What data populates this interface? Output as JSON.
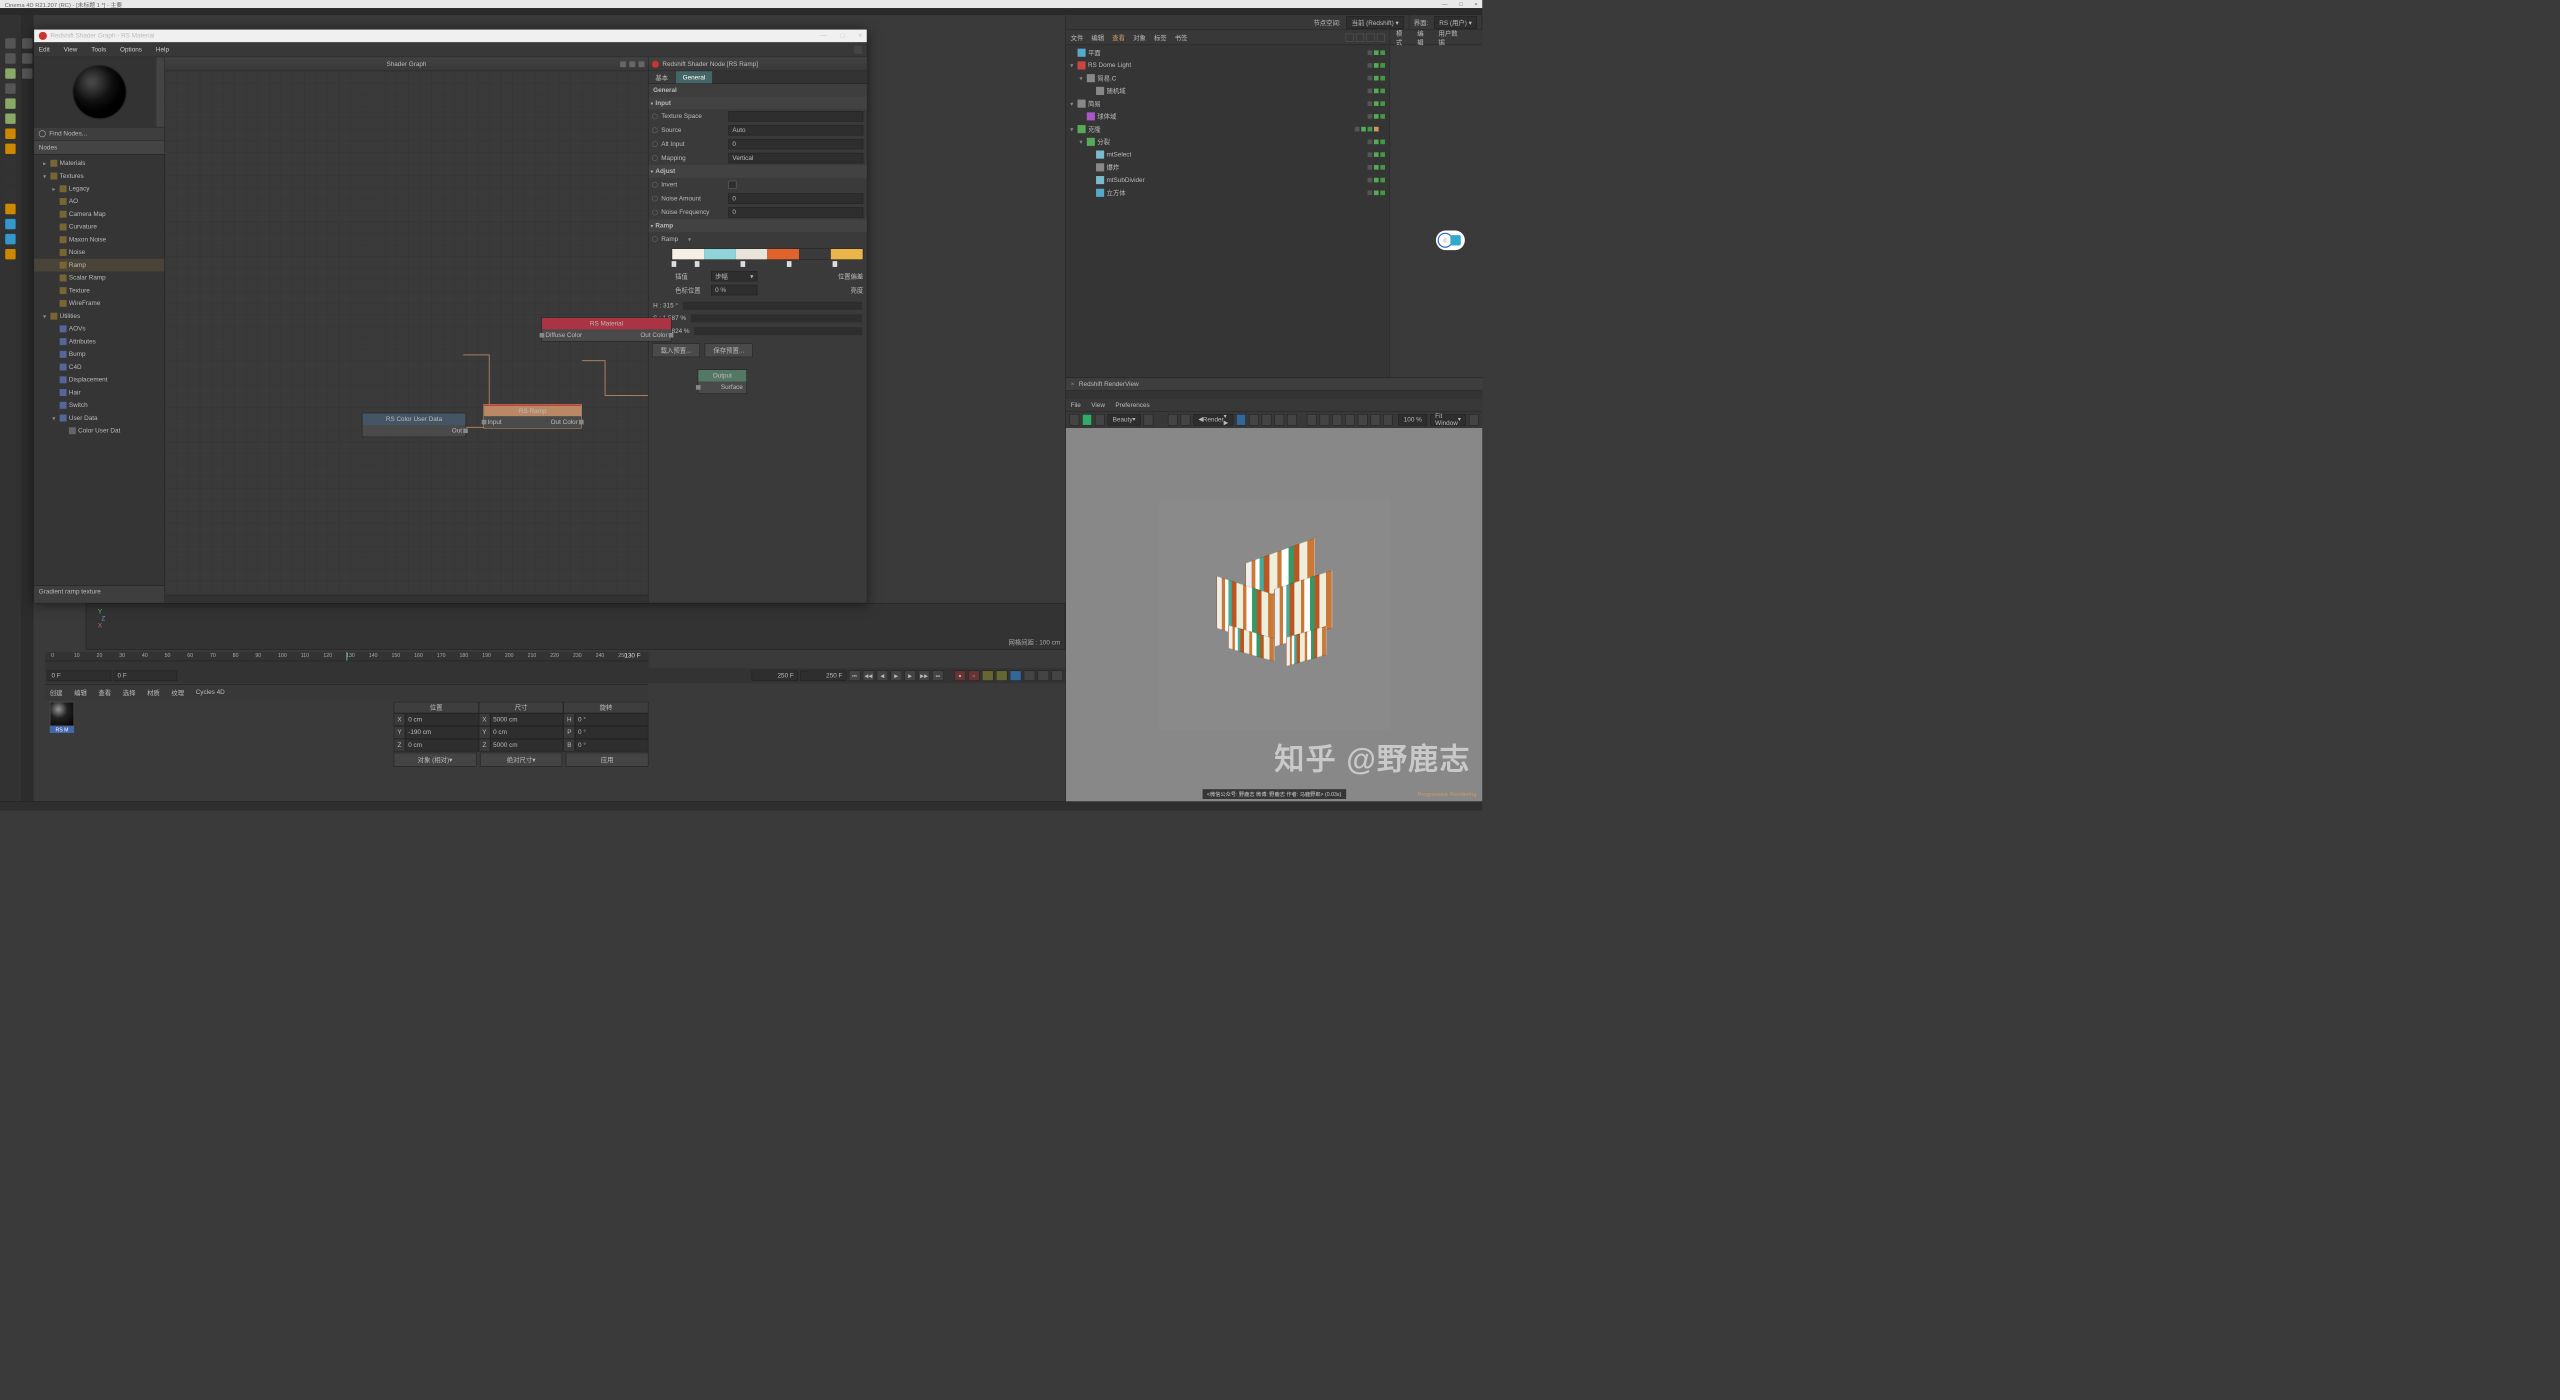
{
  "app_title": "Cinema 4D R21.207 (RC) - [未标题 1 *] - 主要",
  "shader_window": {
    "title": "Redshift Shader Graph - RS Material",
    "menu": [
      "Edit",
      "View",
      "Tools",
      "Options",
      "Help"
    ],
    "graph_header": "Shader Graph",
    "find_placeholder": "Find Nodes...",
    "nodes_header": "Nodes",
    "tree": [
      {
        "label": "Materials",
        "lvl": 0,
        "exp": "▸",
        "ico": "org"
      },
      {
        "label": "Textures",
        "lvl": 0,
        "exp": "▾",
        "ico": "org"
      },
      {
        "label": "Legacy",
        "lvl": 1,
        "exp": "▸",
        "ico": "org"
      },
      {
        "label": "AO",
        "lvl": 1,
        "exp": "",
        "ico": "org"
      },
      {
        "label": "Camera Map",
        "lvl": 1,
        "exp": "",
        "ico": "org"
      },
      {
        "label": "Curvature",
        "lvl": 1,
        "exp": "",
        "ico": "org"
      },
      {
        "label": "Maxon Noise",
        "lvl": 1,
        "exp": "",
        "ico": "org"
      },
      {
        "label": "Noise",
        "lvl": 1,
        "exp": "",
        "ico": "org"
      },
      {
        "label": "Ramp",
        "lvl": 1,
        "exp": "",
        "ico": "org",
        "sel": true
      },
      {
        "label": "Scalar Ramp",
        "lvl": 1,
        "exp": "",
        "ico": "org"
      },
      {
        "label": "Texture",
        "lvl": 1,
        "exp": "",
        "ico": "org"
      },
      {
        "label": "WireFrame",
        "lvl": 1,
        "exp": "",
        "ico": "org"
      },
      {
        "label": "Utilities",
        "lvl": 0,
        "exp": "▾",
        "ico": "org"
      },
      {
        "label": "AOVs",
        "lvl": 1,
        "exp": "",
        "ico": "blue"
      },
      {
        "label": "Attributes",
        "lvl": 1,
        "exp": "",
        "ico": "blue"
      },
      {
        "label": "Bump",
        "lvl": 1,
        "exp": "",
        "ico": "blue"
      },
      {
        "label": "C4D",
        "lvl": 1,
        "exp": "",
        "ico": "blue"
      },
      {
        "label": "Displacement",
        "lvl": 1,
        "exp": "",
        "ico": "blue"
      },
      {
        "label": "Hair",
        "lvl": 1,
        "exp": "",
        "ico": "blue"
      },
      {
        "label": "Switch",
        "lvl": 1,
        "exp": "",
        "ico": "blue"
      },
      {
        "label": "User Data",
        "lvl": 1,
        "exp": "▾",
        "ico": "blue"
      },
      {
        "label": "Color User Dat",
        "lvl": 2,
        "exp": "",
        "ico": "grey"
      }
    ],
    "description": "Gradient ramp texture",
    "nodes": {
      "userdata": {
        "title": "RS Color User Data",
        "out": "Out"
      },
      "ramp": {
        "title": "RS Ramp",
        "in": "Input",
        "out": "Out Color"
      },
      "material": {
        "title": "RS Material",
        "in": "Diffuse Color",
        "out": "Out Color"
      },
      "output": {
        "title": "Output",
        "in": "Surface"
      }
    }
  },
  "props": {
    "header": "Redshift Shader Node [RS Ramp]",
    "tabs": [
      "基本",
      "General"
    ],
    "general": "General",
    "input": "Input",
    "rows": [
      {
        "lbl": "Texture Space",
        "val": ""
      },
      {
        "lbl": "Source",
        "val": "Auto"
      },
      {
        "lbl": "Alt Input",
        "val": "0"
      },
      {
        "lbl": "Mapping",
        "val": "Vertical"
      }
    ],
    "adjust": "Adjust",
    "adjust_rows": [
      {
        "lbl": "Invert",
        "type": "chk"
      },
      {
        "lbl": "Noise Amount",
        "val": "0"
      },
      {
        "lbl": "Noise Frequency",
        "val": "0"
      }
    ],
    "ramp": "Ramp",
    "ramp_lbl": "Ramp",
    "ramp_colors": [
      "#f5f0e6",
      "#8fd4d9",
      "#e8e4da",
      "#e0632b",
      "#3a3a3a",
      "#eab54a"
    ],
    "interp_lbl": "插值",
    "interp_val": "步幅",
    "offset_lbl": "位置偏差",
    "colorpos_lbl": "色标位置",
    "colorpos_val": "0 %",
    "bright_lbl": "亮度",
    "hsv": {
      "h": "H : 315 °",
      "s": "S : 1.587 %",
      "v": "V : 98.824 %"
    },
    "btns": [
      "载入预置...",
      "保存预置..."
    ]
  },
  "topright": {
    "node_space": "节点空间:",
    "node_space_val": "当前 (Redshift)",
    "iface": "界面:",
    "iface_val": "RS (用户)"
  },
  "obj": {
    "menu": [
      "文件",
      "编辑",
      "查看",
      "对象",
      "标签",
      "书签"
    ],
    "items": [
      {
        "lbl": "平面",
        "ind": 0,
        "color": "#5ac",
        "exp": ""
      },
      {
        "lbl": "RS Dome Light",
        "ind": 0,
        "color": "#c44",
        "exp": "▾"
      },
      {
        "lbl": "简易.C",
        "ind": 1,
        "color": "#888",
        "exp": "▾"
      },
      {
        "lbl": "随机域",
        "ind": 2,
        "color": "#888",
        "exp": ""
      },
      {
        "lbl": "简易",
        "ind": 0,
        "color": "#888",
        "exp": "▾"
      },
      {
        "lbl": "球体域",
        "ind": 1,
        "color": "#a5c",
        "exp": ""
      },
      {
        "lbl": "克隆",
        "ind": 0,
        "color": "#5a5",
        "exp": "▾",
        "extra": true
      },
      {
        "lbl": "分裂",
        "ind": 1,
        "color": "#5a5",
        "exp": "▾"
      },
      {
        "lbl": "mtSelect",
        "ind": 2,
        "color": "#7bc",
        "exp": ""
      },
      {
        "lbl": "爆炸",
        "ind": 2,
        "color": "#888",
        "exp": ""
      },
      {
        "lbl": "mtSubDivider",
        "ind": 2,
        "color": "#7bc",
        "exp": ""
      },
      {
        "lbl": "立方体",
        "ind": 2,
        "color": "#5ac",
        "exp": ""
      }
    ]
  },
  "attr": {
    "menu": [
      "模式",
      "编辑",
      "用户数据"
    ]
  },
  "rv": {
    "title": "Redshift RenderView",
    "menu": [
      "File",
      "View",
      "Preferences"
    ],
    "beauty": "Beauty",
    "render": "Render",
    "zoom": "100 %",
    "fit": "Fit Window",
    "status": "<微信公众号: 野鹿志   微博: 野鹿志   作者: 马鹿野郎>  (0.03s)",
    "prog": "Progressive Rendering"
  },
  "viewport": {
    "grid": "网格间距 : 100 cm"
  },
  "timeline": {
    "marks": [
      0,
      10,
      20,
      30,
      40,
      50,
      60,
      70,
      80,
      90,
      100,
      110,
      120,
      130,
      140,
      150,
      160,
      170,
      180,
      190,
      200,
      210,
      220,
      230,
      240,
      250
    ],
    "cur": 130,
    "cur_lbl": "130 F",
    "start": "0 F",
    "start2": "0 F",
    "end": "250 F",
    "end2": "250 F"
  },
  "attrbar": [
    "创建",
    "编辑",
    "查看",
    "选择",
    "材质",
    "纹理",
    "Cycles 4D"
  ],
  "mat": "RS M",
  "coords": {
    "headers": [
      "位置",
      "尺寸",
      "旋转"
    ],
    "rows": [
      {
        "a": "X",
        "p": "0 cm",
        "s": "X",
        "sv": "5000 cm",
        "r": "H",
        "rv": "0 °"
      },
      {
        "a": "Y",
        "p": "-190 cm",
        "s": "Y",
        "sv": "0 cm",
        "r": "P",
        "rv": "0 °"
      },
      {
        "a": "Z",
        "p": "0 cm",
        "s": "Z",
        "sv": "5000 cm",
        "r": "B",
        "rv": "0 °"
      }
    ],
    "btns": [
      "对象 (相对)",
      "绝对尺寸",
      "应用"
    ]
  },
  "watermark": "知乎 @野鹿志"
}
